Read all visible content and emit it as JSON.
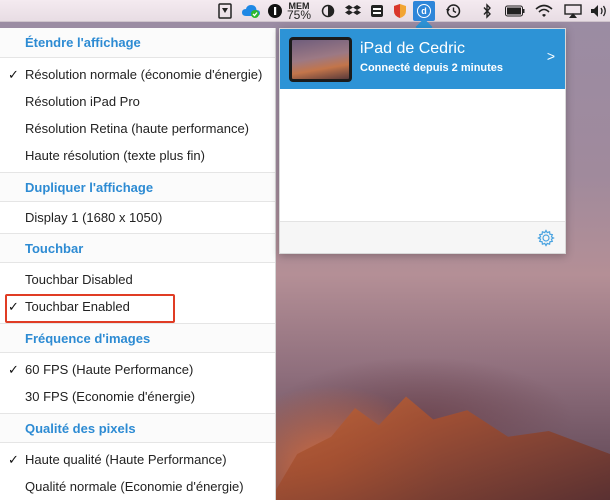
{
  "menubar": {
    "mem_label": "MEM",
    "mem_pct": "75%",
    "icons": [
      "screenshot-icon",
      "cloud-sync-icon",
      "one-password-icon",
      "memory-monitor-icon",
      "flux-icon",
      "dropbox-icon",
      "kensington-icon",
      "shield-icon",
      "duet-icon",
      "time-machine-icon",
      "bluetooth-icon",
      "battery-icon",
      "wifi-icon",
      "airplay-icon",
      "volume-icon"
    ],
    "duet_glyph": "d"
  },
  "menu": {
    "sections": [
      {
        "title": "Étendre l'affichage",
        "items": [
          {
            "label": "Résolution normale (économie d'énergie)",
            "checked": true
          },
          {
            "label": "Résolution iPad Pro",
            "checked": false
          },
          {
            "label": "Résolution Retina (haute performance)",
            "checked": false
          },
          {
            "label": "Haute résolution (texte plus fin)",
            "checked": false
          }
        ]
      },
      {
        "title": "Dupliquer l'affichage",
        "items": [
          {
            "label": "Display 1 (1680 x 1050)",
            "checked": false
          }
        ]
      },
      {
        "title": "Touchbar",
        "items": [
          {
            "label": "Touchbar Disabled",
            "checked": false
          },
          {
            "label": "Touchbar Enabled",
            "checked": true,
            "highlighted": true
          }
        ]
      },
      {
        "title": "Fréquence d'images",
        "items": [
          {
            "label": "60 FPS (Haute Performance)",
            "checked": true
          },
          {
            "label": "30 FPS (Economie d'énergie)",
            "checked": false
          }
        ]
      },
      {
        "title": "Qualité des pixels",
        "items": [
          {
            "label": "Haute qualité (Haute Performance)",
            "checked": true
          },
          {
            "label": "Qualité normale (Economie d'énergie)",
            "checked": false
          }
        ]
      }
    ],
    "check_glyph": "✓"
  },
  "popover": {
    "device_name": "iPad de Cedric",
    "device_status": "Connecté depuis 2 minutes",
    "chevron": ">"
  },
  "colors": {
    "accent": "#2d93d6",
    "section_title": "#2d8bd3",
    "highlight_border": "#e03c24"
  }
}
